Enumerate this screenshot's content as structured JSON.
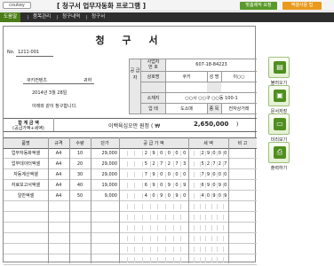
{
  "header": {
    "logo": "coukey",
    "title": "[ 청구서 업무자동화 프로그램 ]",
    "btn_request": "맞춤제작 요청",
    "btn_guide": "엑셀사용 팁",
    "colors": {
      "accent_green": "#4a7d17",
      "btn_green": "#5b9a2a",
      "btn_orange": "#e99a1c",
      "menu_bg": "#2e2e2e"
    }
  },
  "menu": {
    "items": [
      {
        "label": "도움말"
      },
      {
        "label": "품목관리"
      },
      {
        "label": "청구내역"
      },
      {
        "label": "청구서"
      }
    ]
  },
  "doc": {
    "title": "청 구 서",
    "no_label": "No.",
    "no_value": "1211-001",
    "client": "쿠키컨텐츠",
    "honorific": "귀하",
    "date": "2014년  3월  28일",
    "request_text": "아래와 같이 청구합니다.",
    "supplier_label": "공 급 자",
    "reg_no_label": "사업자\n번 호",
    "reg_no": "607-18-84223",
    "company_label": "상호명",
    "company": "쿠키",
    "name_label": "성 명",
    "name": "이○○",
    "address_label": "소재지",
    "address": "○○시 ○○구 ○○동 100-1",
    "biz_type_label": "업 태",
    "biz_type": "도소매",
    "biz_item_label": "종 목",
    "biz_item": "전자상거래",
    "total_label_1": "합 계 금 액",
    "total_label_2": "(공급가액+세액)",
    "total_text": "이백육십오만 원정  (  ₩",
    "total_amount": "2,650,000",
    "total_close": ")"
  },
  "table": {
    "headers": {
      "item": "품명",
      "spec": "규격",
      "qty": "수량",
      "price": "단가",
      "supply": "공 급 가 액",
      "tax": "세    액",
      "note": "비 고"
    },
    "rows": [
      {
        "item": "업무자동화엑셀",
        "spec": "A4",
        "qty": "10",
        "price": "29,000",
        "supply_digits": [
          "2",
          "9",
          "0",
          "0",
          "0",
          "0"
        ],
        "tax_digits": [
          "2",
          "9",
          "0",
          "0",
          "0"
        ]
      },
      {
        "item": "업무데이터엑셀",
        "spec": "A4",
        "qty": "20",
        "price": "29,000",
        "supply_digits": [
          "5",
          "2",
          "7",
          "2",
          "7",
          "3"
        ],
        "tax_digits": [
          "5",
          "2",
          "7",
          "2",
          "7"
        ]
      },
      {
        "item": "자동계산엑셀",
        "spec": "A4",
        "qty": "30",
        "price": "29,000",
        "supply_digits": [
          "7",
          "9",
          "0",
          "0",
          "0",
          "0"
        ],
        "tax_digits": [
          "7",
          "9",
          "0",
          "0",
          "0"
        ]
      },
      {
        "item": "자료보고서엑셀",
        "spec": "A4",
        "qty": "40",
        "price": "19,000",
        "supply_digits": [
          "6",
          "9",
          "0",
          "9",
          "0",
          "9"
        ],
        "tax_digits": [
          "6",
          "9",
          "0",
          "9",
          "0"
        ]
      },
      {
        "item": "일반엑셀",
        "spec": "A4",
        "qty": "50",
        "price": "9,000",
        "supply_digits": [
          "4",
          "0",
          "9",
          "0",
          "9",
          "0"
        ],
        "tax_digits": [
          "4",
          "0",
          "9",
          "0",
          "9"
        ]
      }
    ],
    "empty_rows": 6
  },
  "side": {
    "buttons": [
      {
        "label": "불러오기",
        "icon": "folder-open-icon",
        "glyph": "▤"
      },
      {
        "label": "문서저장",
        "icon": "save-icon",
        "glyph": "▣"
      },
      {
        "label": "미리보기",
        "icon": "preview-icon",
        "glyph": "▭"
      },
      {
        "label": "출력하기",
        "icon": "print-icon",
        "glyph": "⎙"
      }
    ]
  }
}
